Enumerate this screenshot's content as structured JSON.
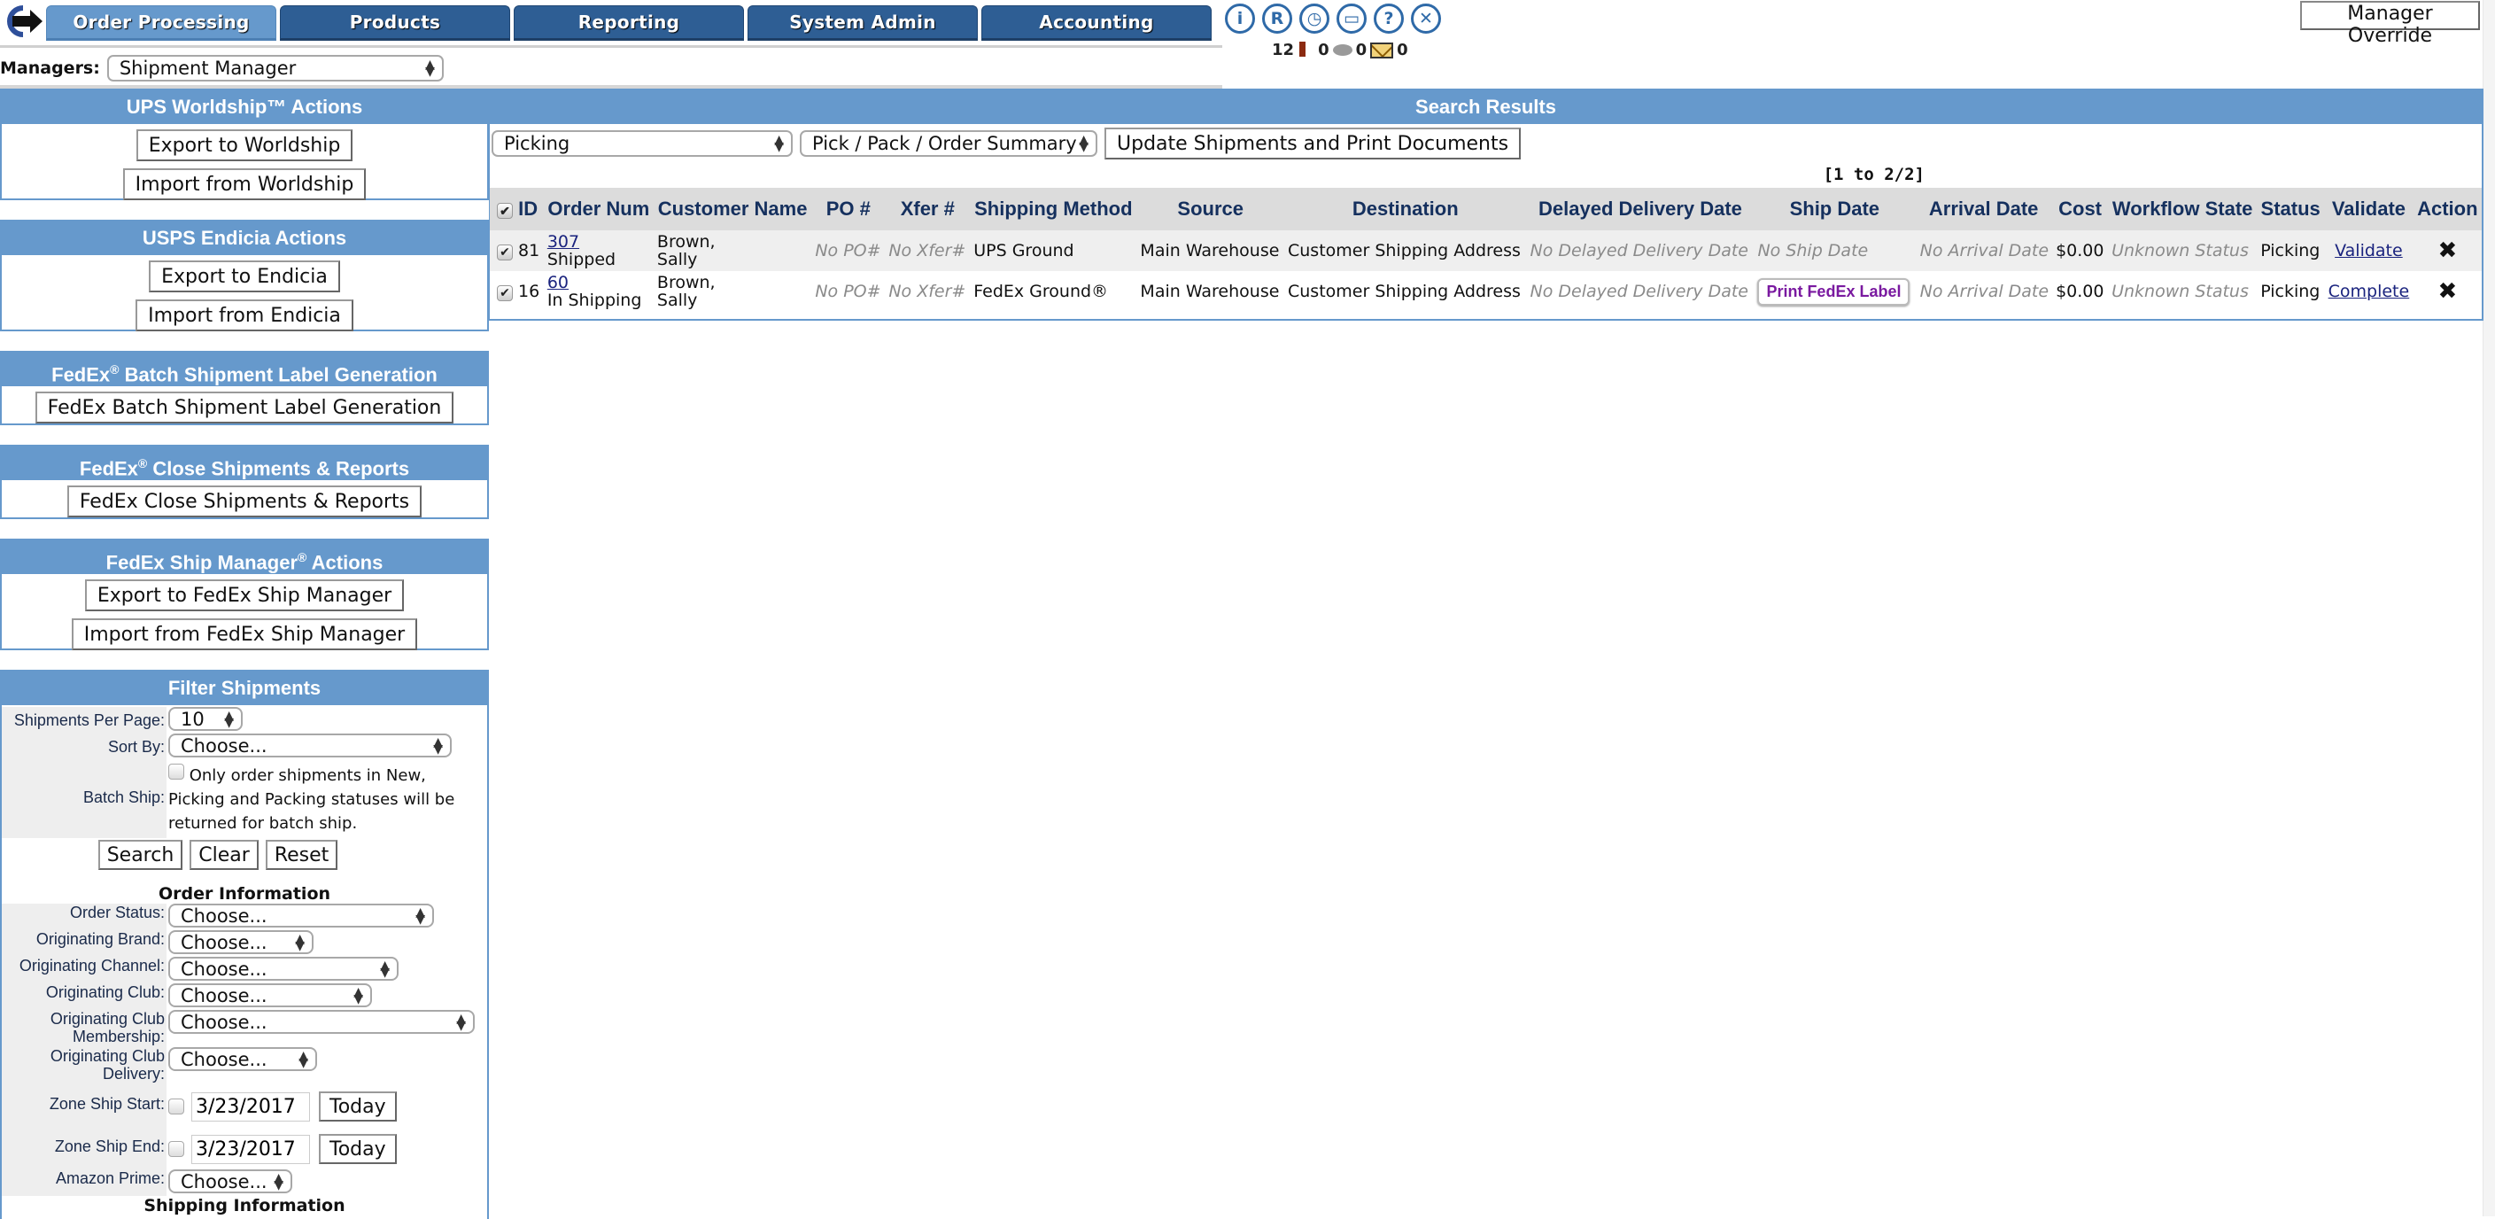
{
  "nav": {
    "logo": "back-arrow-logo",
    "tabs": [
      {
        "label": "Order Processing",
        "active": true
      },
      {
        "label": "Products",
        "active": false
      },
      {
        "label": "Reporting",
        "active": false
      },
      {
        "label": "System Admin",
        "active": false
      },
      {
        "label": "Accounting",
        "active": false
      }
    ],
    "icons": [
      {
        "name": "info-icon",
        "glyph": "i"
      },
      {
        "name": "registered-icon",
        "glyph": "R"
      },
      {
        "name": "clock-icon",
        "glyph": "◷"
      },
      {
        "name": "monitor-icon",
        "glyph": "▭"
      },
      {
        "name": "help-icon",
        "glyph": "?"
      },
      {
        "name": "close-icon",
        "glyph": "✕"
      }
    ],
    "counters": {
      "alerts": "12",
      "comments": "0",
      "messages_prefix": "0",
      "messages": "0"
    },
    "manager_override": "Manager Override"
  },
  "managers": {
    "label": "Managers:",
    "selected": "Shipment Manager"
  },
  "panels": {
    "ups": {
      "title": "UPS Worldship™ Actions",
      "buttons": [
        "Export to Worldship",
        "Import from Worldship"
      ]
    },
    "usps": {
      "title": "USPS Endicia Actions",
      "buttons": [
        "Export to Endicia",
        "Import from Endicia"
      ]
    },
    "fedex_batch": {
      "title_pre": "FedEx",
      "title_sup": "®",
      "title_post": " Batch Shipment Label Generation",
      "buttons": [
        "FedEx Batch Shipment Label Generation"
      ]
    },
    "fedex_close": {
      "title_pre": "FedEx",
      "title_sup": "®",
      "title_post": " Close Shipments & Reports",
      "buttons": [
        "FedEx Close Shipments & Reports"
      ]
    },
    "fedex_ship": {
      "title_pre": "FedEx Ship Manager",
      "title_sup": "®",
      "title_post": " Actions",
      "buttons": [
        "Export to FedEx Ship Manager",
        "Import from FedEx Ship Manager"
      ]
    }
  },
  "filter": {
    "title": "Filter Shipments",
    "per_page_label": "Shipments Per Page:",
    "per_page_value": "10",
    "sort_label": "Sort By:",
    "sort_value": "Choose...",
    "batch_label": "Batch Ship:",
    "batch_text": "Only order shipments in New, Picking and Packing statuses will be returned for batch ship.",
    "buttons": {
      "search": "Search",
      "clear": "Clear",
      "reset": "Reset"
    },
    "order_info_title": "Order Information",
    "order_fields": [
      {
        "label": "Order Status:",
        "value": "Choose..."
      },
      {
        "label": "Originating Brand:",
        "value": "Choose..."
      },
      {
        "label": "Originating Channel:",
        "value": "Choose..."
      },
      {
        "label": "Originating Club:",
        "value": "Choose..."
      },
      {
        "label": "Originating Club Membership:",
        "value": "Choose..."
      },
      {
        "label": "Originating Club Delivery:",
        "value": "Choose..."
      }
    ],
    "zone_start": {
      "label": "Zone Ship Start:",
      "date": "3/23/2017",
      "button": "Today"
    },
    "zone_end": {
      "label": "Zone Ship End:",
      "date": "3/23/2017",
      "button": "Today"
    },
    "amazon_prime": {
      "label": "Amazon Prime:",
      "value": "Choose..."
    },
    "shipping_info_title": "Shipping Information"
  },
  "results": {
    "title": "Search Results",
    "status_select": "Picking",
    "doc_select": "Pick / Pack / Order Summary",
    "update_button": "Update Shipments and Print Documents",
    "pagination": "[1 to 2/2]",
    "columns": [
      "ID",
      "Order Num",
      "Customer Name",
      "PO #",
      "Xfer #",
      "Shipping Method",
      "Source",
      "Destination",
      "Delayed Delivery Date",
      "Ship Date",
      "Arrival Date",
      "Cost",
      "Workflow State",
      "Status",
      "Validate",
      "Action"
    ],
    "rows": [
      {
        "checked": true,
        "id": "81",
        "order_num": "307",
        "order_status": "Shipped",
        "customer_last": "Brown,",
        "customer_first": "Sally",
        "po": "No PO#",
        "xfer": "No Xfer#",
        "shipping_method": "UPS Ground",
        "source": "Main Warehouse",
        "destination": "Customer Shipping Address",
        "delayed_delivery": "No Delayed Delivery Date",
        "ship_date": "No Ship Date",
        "ship_date_is_button": false,
        "arrival_date": "No Arrival Date",
        "cost": "$0.00",
        "workflow_state": "Unknown Status",
        "status": "Picking",
        "validate": "Validate",
        "action_icon": "tools-icon"
      },
      {
        "checked": true,
        "id": "16",
        "order_num": "60",
        "order_status": "In Shipping",
        "customer_last": "Brown,",
        "customer_first": "Sally",
        "po": "No PO#",
        "xfer": "No Xfer#",
        "shipping_method": "FedEx Ground®",
        "source": "Main Warehouse",
        "destination": "Customer Shipping Address",
        "delayed_delivery": "No Delayed Delivery Date",
        "ship_date": "Print FedEx Label",
        "ship_date_is_button": true,
        "arrival_date": "No Arrival Date",
        "cost": "$0.00",
        "workflow_state": "Unknown Status",
        "status": "Picking",
        "validate": "Complete",
        "action_icon": "tools-icon"
      }
    ]
  },
  "colors": {
    "panel_header": "#6699cc",
    "tab_active": "#6699cc",
    "tab_inactive": "#2e5e94",
    "link": "#1a237e",
    "fedex_label": "#7a1aa0"
  }
}
